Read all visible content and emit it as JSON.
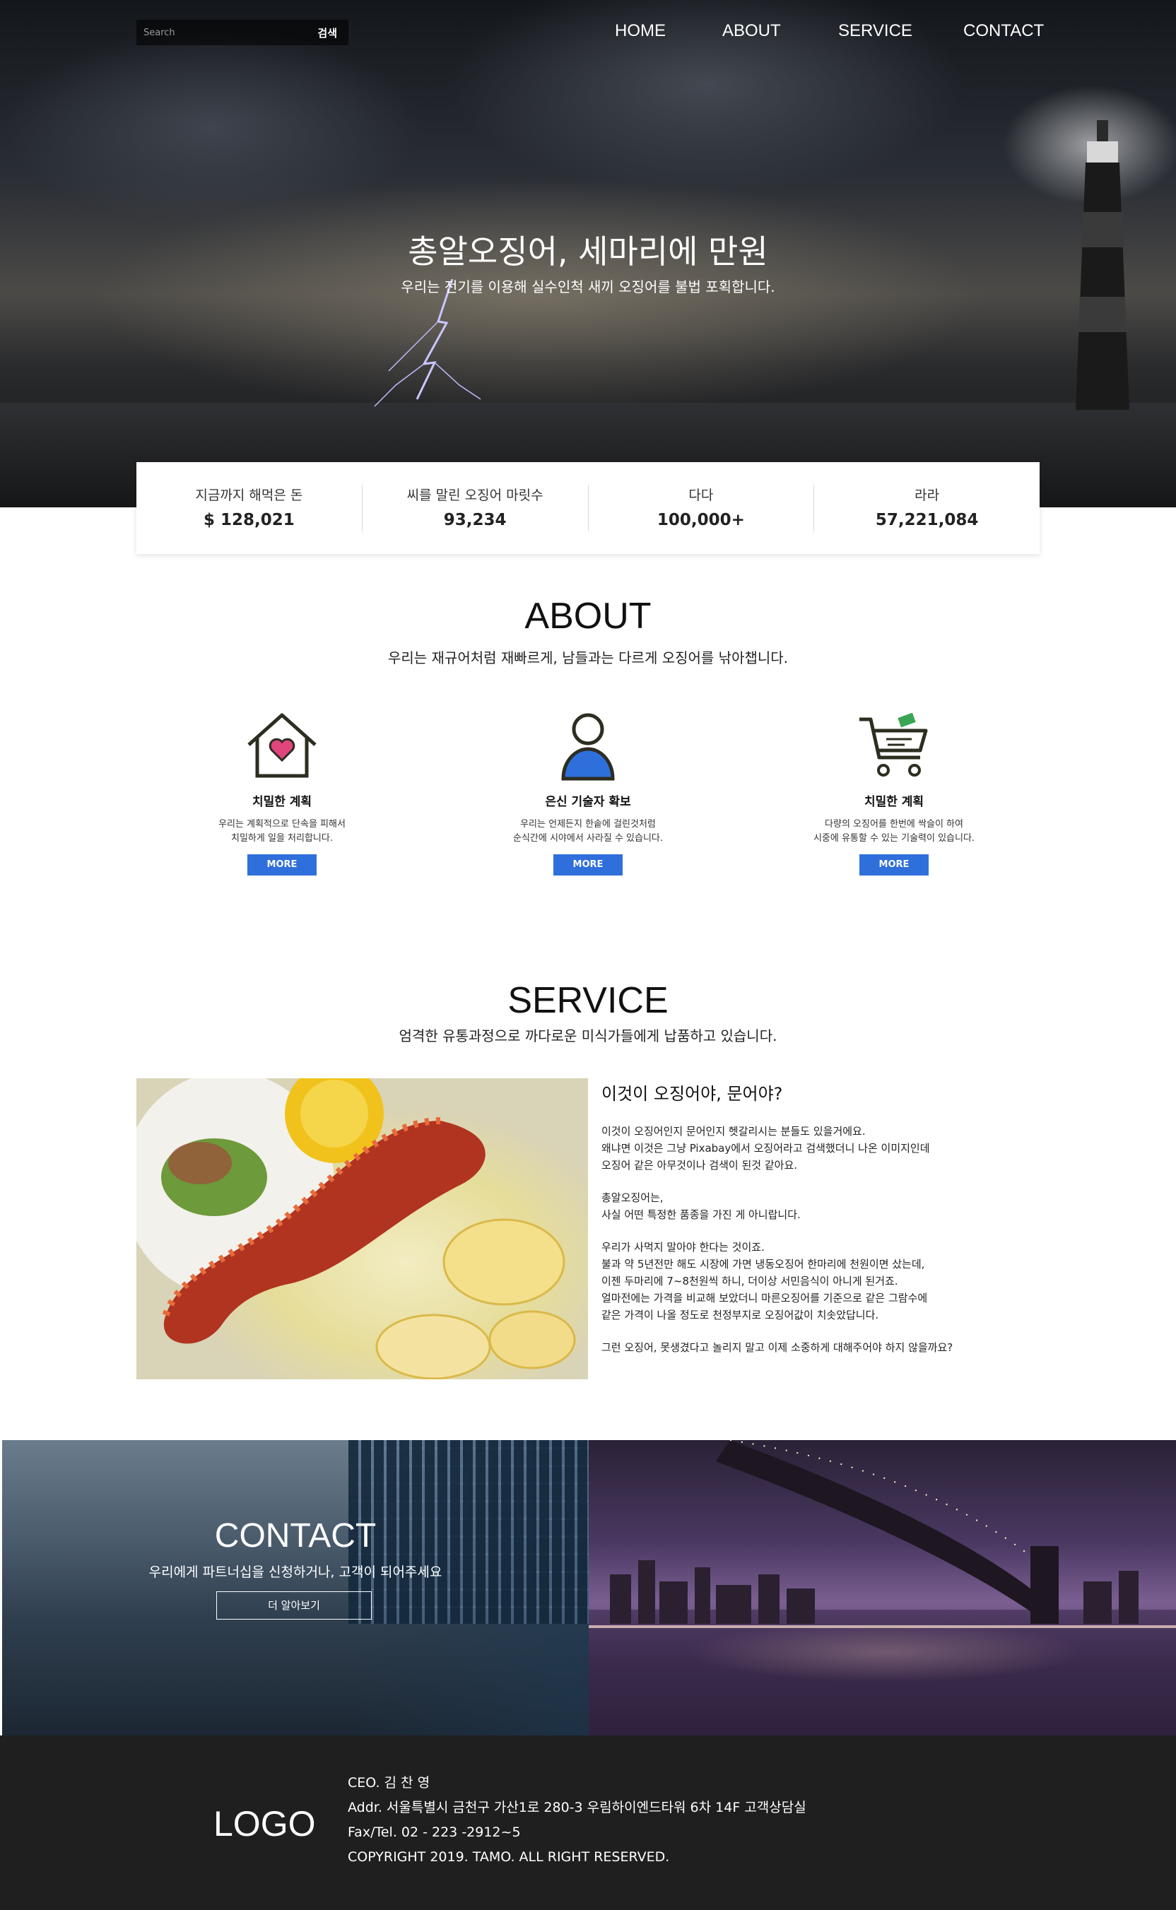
{
  "search": {
    "placeholder": "Search",
    "button_label": "검색"
  },
  "nav": {
    "items": [
      "HOME",
      "ABOUT",
      "SERVICE",
      "CONTACT"
    ]
  },
  "hero": {
    "title": "총알오징어, 세마리에 만원",
    "subtitle": "우리는 전기를 이용해 실수인척 새끼 오징어를 불법 포획합니다."
  },
  "stats": [
    {
      "label": "지금까지 해먹은 돈",
      "value": "$ 128,021"
    },
    {
      "label": "씨를 말린 오징어 마릿수",
      "value": "93,234"
    },
    {
      "label": "다다",
      "value": "100,000+"
    },
    {
      "label": "라라",
      "value": "57,221,084"
    }
  ],
  "about": {
    "title": "ABOUT",
    "subtitle": "우리는 재규어처럼 재빠르게, 남들과는 다르게 오징어를 낚아챕니다.",
    "cards": [
      {
        "icon": "house-heart-icon",
        "title": "치밀한 계획",
        "desc1": "우리는 계획적으로 단속을 피해서",
        "desc2": "치밀하게 일을 처리합니다.",
        "button": "MORE"
      },
      {
        "icon": "user-icon",
        "title": "은신 기술자 확보",
        "desc1": "우리는 언제든지 한솥에 걸린것처럼",
        "desc2": "순식간에 시야에서 사라질 수 있습니다.",
        "button": "MORE"
      },
      {
        "icon": "shopping-cart-icon",
        "title": "치밀한 계획",
        "desc1": "다량의 오징어를 한번에 싹슬이 하여",
        "desc2": "시중에 유통할 수 있는 기술력이 있습니다.",
        "button": "MORE"
      }
    ]
  },
  "service": {
    "title": "SERVICE",
    "subtitle": "엄격한 유통과정으로 까다로운 미식가들에게 납품하고 있습니다.",
    "heading": "이것이 오징어야, 문어야?",
    "p1": [
      "이것이 오징어인지 문어인지 헷갈리시는 분들도 있을거에요.",
      "왜냐면 이것은 그냥 Pixabay에서 오징어라고 검색했더니 나온 이미지인데",
      "오징어 같은 아무것이나 검색이 된것 같아요."
    ],
    "p2": [
      "총알오징어는,",
      "사실 어떤 특정한 품종을 가진 게 아니랍니다."
    ],
    "p3": [
      "우리가 사먹지 말아야 한다는 것이죠.",
      "불과 약 5년전만 해도 시장에 가면 냉동오징어 한마리에 천원이면 샀는데,",
      "이젠 두마리에 7~8천원씩 하니, 더이상 서민음식이 아니게 된거죠.",
      "얼마전에는 가격을 비교해 보았더니 마른오징어를 기준으로 같은 그람수에",
      "같은 가격이 나올 정도로 천정부지로 오징어값이 치솟았답니다."
    ],
    "p4": "그런 오징어, 못생겼다고 놀리지 말고 이제 소중하게 대해주어야 하지 않을까요?"
  },
  "contact": {
    "title": "CONTACT",
    "subtitle": "우리에게 파트너십을 신청하거나, 고객이 되어주세요",
    "button": "더 알아보기"
  },
  "footer": {
    "logo": "LOGO",
    "ceo": "CEO. 김 찬 영",
    "addr": "Addr. 서울특별시 금천구 가산1로 280-3 우림하이엔드타워 6차 14F 고객상담실",
    "tel": "Fax/Tel. 02 - 223 -2912~5",
    "copyright": "COPYRIGHT 2019. TAMO. ALL RIGHT RESERVED."
  },
  "colors": {
    "accent": "#2f6fdc",
    "about_bg": "#f1f2f4",
    "footer_bg": "#1f1f1f"
  }
}
